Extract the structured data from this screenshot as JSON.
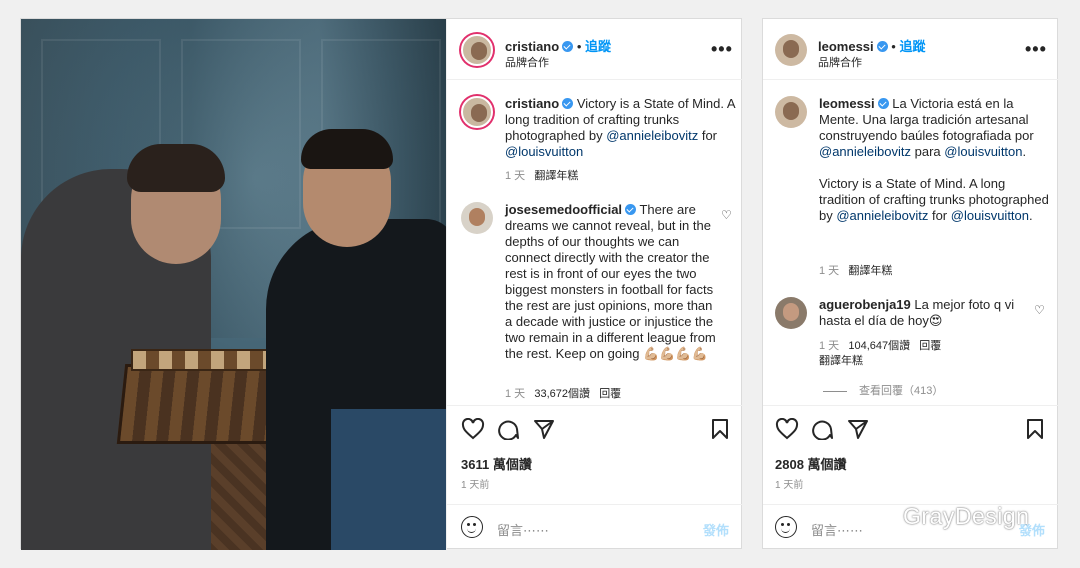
{
  "post1": {
    "username": "cristiano",
    "follow": "追蹤",
    "subtitle": "品牌合作",
    "more": "•••",
    "caption": {
      "username": "cristiano",
      "text_a": "Victory is a State of Mind. A long tradition of crafting trunks photographed by",
      "mention1": "@annieleibovitz",
      "for": "for",
      "mention2": "@louisvuitton",
      "time": "1 天",
      "translate": "翻譯年糕"
    },
    "comment": {
      "username": "josesemedoofficial",
      "text": "There are dreams we cannot reveal, but in the depths of our thoughts we can connect directly with the creator the rest is in front of our eyes the two biggest monsters in football for facts the rest are just opinions, more than a decade with justice or injustice the two remain in a different league from the rest. Keep on going 💪🏼💪🏼💪🏼💪🏼",
      "time": "1 天",
      "likes": "33,672個讚",
      "reply": "回覆"
    },
    "likes": "3611 萬個讚",
    "ago": "1 天前",
    "input_placeholder": "留言⋯⋯",
    "post_button": "發佈"
  },
  "post2": {
    "username": "leomessi",
    "follow": "追蹤",
    "subtitle": "品牌合作",
    "more": "•••",
    "caption": {
      "username": "leomessi",
      "text_a": "La Victoria está en la Mente. Una larga tradición artesanal construyendo baúles fotografiada por",
      "mention1": "@annieleibovitz",
      "para": "para",
      "mention2": "@louisvuitton",
      "period": ".",
      "text_b": "Victory is a State of Mind. A long tradition of crafting trunks photographed by",
      "mention3": "@annieleibovitz",
      "for": "for",
      "mention4": "@louisvuitton",
      "time": "1 天",
      "translate": "翻譯年糕"
    },
    "comment": {
      "username": "aguerobenja19",
      "text": "La mejor foto q vi hasta el día de hoy😍",
      "time": "1 天",
      "likes": "104,647個讚",
      "reply": "回覆",
      "translate": "翻譯年糕",
      "view_replies": "查看回覆（413）"
    },
    "likes": "2808 萬個讚",
    "ago": "1 天前",
    "input_placeholder": "留言⋯⋯",
    "post_button": "發佈"
  },
  "watermark": "GrayDesign",
  "colors": {
    "link": "#00376b",
    "follow": "#0095f6",
    "verified": "#3897f0"
  }
}
